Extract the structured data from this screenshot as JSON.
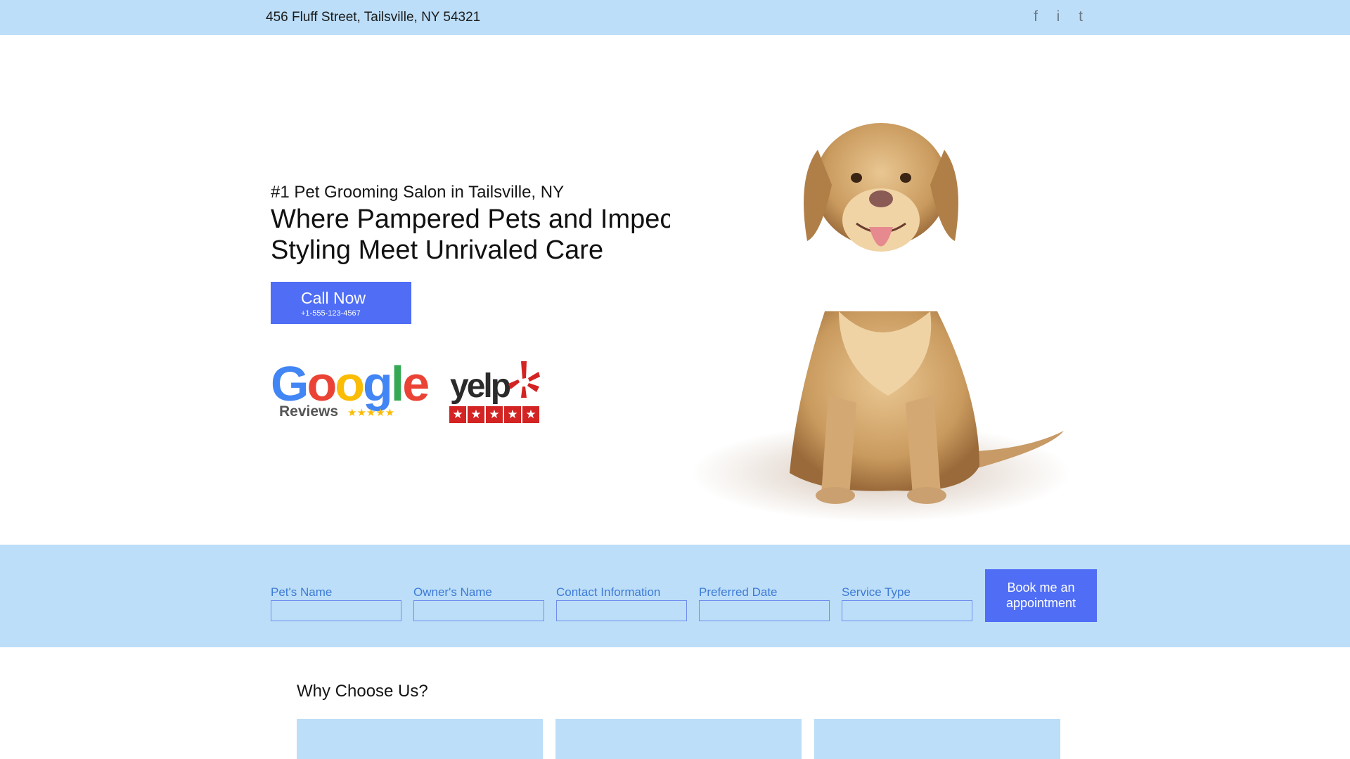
{
  "topbar": {
    "address": "456 Fluff Street, Tailsville, NY 54321",
    "social": [
      {
        "icon": "facebook-icon",
        "glyph": "f"
      },
      {
        "icon": "instagram-icon",
        "glyph": "i"
      },
      {
        "icon": "twitter-icon",
        "glyph": "t"
      }
    ]
  },
  "hero": {
    "subtitle": "#1 Pet Grooming Salon in Tailsville, NY",
    "title": "Where Pampered Pets and Impeccable Styling Meet Unrivaled Care",
    "call_button": {
      "label": "Call Now",
      "phone": "+1-555-123-4567"
    },
    "badges": {
      "google": {
        "wordmark": "Google",
        "sub": "Reviews",
        "stars": "★★★★★"
      },
      "yelp": {
        "wordmark": "yelp",
        "stars": [
          "★",
          "★",
          "★",
          "★",
          "★"
        ]
      }
    },
    "image": "dog-illustration"
  },
  "booking": {
    "fields": [
      {
        "label": "Pet's Name"
      },
      {
        "label": "Owner's Name"
      },
      {
        "label": "Contact Information"
      },
      {
        "label": "Preferred Date"
      },
      {
        "label": "Service Type"
      }
    ],
    "submit_label": "Book me an appointment"
  },
  "why": {
    "title": "Why Choose Us?"
  },
  "colors": {
    "band": "#bcdef8",
    "accent": "#4f6df5",
    "label": "#3e7bd6"
  }
}
